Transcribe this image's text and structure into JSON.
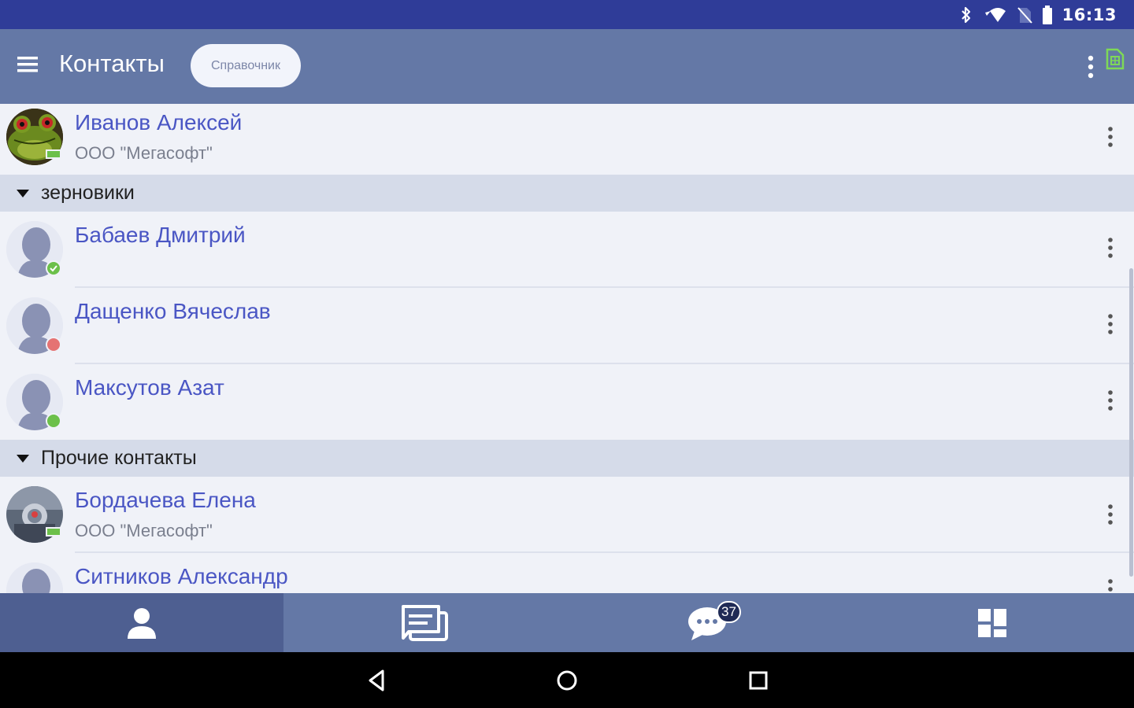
{
  "status_bar": {
    "time": "16:13",
    "icons": [
      "bluetooth-icon",
      "wifi-icon",
      "no-sim-icon",
      "battery-icon"
    ]
  },
  "app_bar": {
    "title": "Контакты",
    "chip_label": "Справочник",
    "icons": [
      "menu-icon",
      "more-vert-icon",
      "sim-card-icon"
    ]
  },
  "contacts_top": [
    {
      "name": "Иванов Алексей",
      "company": "ООО \"Мегасофт\"",
      "avatar": "frog-photo",
      "status": "desktop-online"
    }
  ],
  "groups": [
    {
      "label": "зерновики",
      "contacts": [
        {
          "name": "Бабаев Дмитрий",
          "company": "",
          "avatar": "placeholder",
          "status": "online-check"
        },
        {
          "name": "Дащенко Вячеслав",
          "company": "",
          "avatar": "placeholder",
          "status": "busy"
        },
        {
          "name": "Максутов Азат",
          "company": "",
          "avatar": "placeholder",
          "status": "online"
        }
      ]
    },
    {
      "label": "Прочие контакты",
      "contacts": [
        {
          "name": "Бордачева Елена",
          "company": "ООО \"Мегасофт\"",
          "avatar": "photo",
          "status": "desktop-online"
        },
        {
          "name": "Ситников Александр",
          "company": "",
          "avatar": "placeholder",
          "status": ""
        }
      ]
    }
  ],
  "colors": {
    "status_bar": "#2f3c98",
    "app_bar": "#6478a6",
    "name_text": "#4a56c4",
    "online": "#6cc04a",
    "busy": "#e57373"
  },
  "bottom_nav": {
    "tabs": [
      "contacts-tab",
      "conversations-tab",
      "chats-tab",
      "apps-tab"
    ],
    "active_tab": "contacts-tab",
    "chats_badge": "37"
  },
  "system_nav": [
    "back-icon",
    "home-icon",
    "recents-icon"
  ]
}
